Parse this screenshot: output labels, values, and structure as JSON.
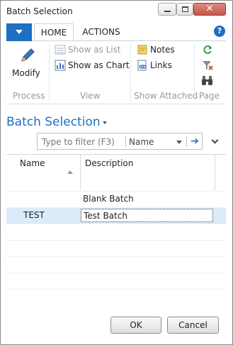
{
  "window": {
    "title": "Batch Selection",
    "close_glyph": "✕"
  },
  "ribbon_tabs": {
    "home": "HOME",
    "actions": "ACTIONS"
  },
  "ribbon": {
    "groups": {
      "process": "Process",
      "view": "View",
      "show_attached": "Show Attached",
      "page": "Page"
    },
    "buttons": {
      "modify": "Modify",
      "show_as_list": "Show as List",
      "show_as_chart": "Show as Chart",
      "notes": "Notes",
      "links": "Links"
    }
  },
  "page": {
    "title": "Batch Selection",
    "filter_placeholder": "Type to filter (F3)",
    "filter_field": "Name"
  },
  "table": {
    "columns": [
      "Name",
      "Description"
    ],
    "rows": [
      {
        "name": "",
        "description": "Blank Batch"
      },
      {
        "name": "TEST",
        "description": "Test Batch"
      }
    ]
  },
  "footer": {
    "ok": "OK",
    "cancel": "Cancel"
  },
  "colors": {
    "accent": "#1e6fc4",
    "selected_row": "#dcebfa"
  }
}
